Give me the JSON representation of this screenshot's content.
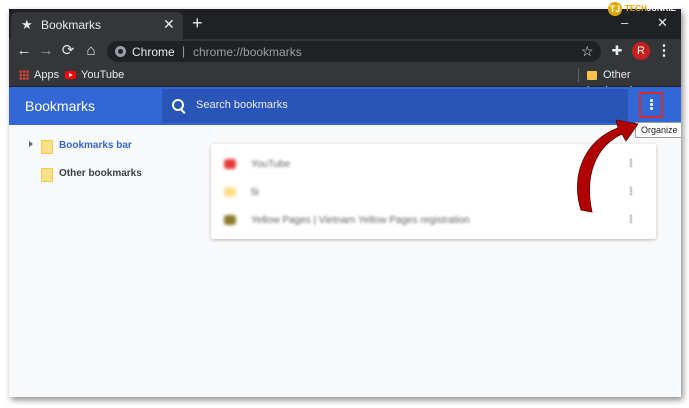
{
  "browser": {
    "tab": {
      "title": "Bookmarks",
      "icon": "star-icon"
    },
    "new_tab_symbol": "+",
    "omnibox": {
      "host": "Chrome",
      "separator": "|",
      "url": "chrome://bookmarks"
    },
    "avatar_initial": "R"
  },
  "bookmarks_bar": {
    "items": [
      {
        "label": "Apps",
        "icon": "apps-grid-icon"
      },
      {
        "label": "YouTube",
        "icon": "youtube-icon"
      }
    ],
    "other": {
      "label": "Other bookmarks",
      "icon": "folder-icon"
    }
  },
  "page": {
    "title": "Bookmarks",
    "search_placeholder": "Search bookmarks",
    "menu_tooltip": "Organize"
  },
  "sidebar": {
    "folders": [
      {
        "label": "Bookmarks bar",
        "selected": true,
        "expandable": true
      },
      {
        "label": "Other bookmarks",
        "selected": false,
        "expandable": false
      }
    ]
  },
  "list": {
    "rows": [
      {
        "text": "YouTube",
        "icon_color": "#e53935"
      },
      {
        "text": "5i",
        "icon_color": "#fbe08a"
      },
      {
        "text": "Yellow Pages | Vietnam Yellow Pages registration",
        "icon_color": "#8a7a2a"
      }
    ]
  },
  "watermark": {
    "prefix": "TECH",
    "suffix": "JUNKIE",
    "logo": "TJ"
  },
  "colors": {
    "header_blue": "#3367d6",
    "search_blue": "#2955b8",
    "highlight_red": "#d32f2f",
    "arrow_red": "#b00000",
    "selected_link": "#3367d6"
  }
}
